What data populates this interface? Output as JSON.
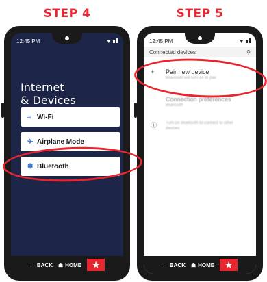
{
  "steps": {
    "step4": {
      "label": "STEP 4"
    },
    "step5": {
      "label": "STEP 5"
    }
  },
  "phone4": {
    "time": "12:45 PM",
    "title_line1": "Internet",
    "title_line2": "& Devices",
    "menu": [
      {
        "label": "Wi-Fi",
        "icon": "wifi-icon"
      },
      {
        "label": "Airplane Mode",
        "icon": "airplane-icon"
      },
      {
        "label": "Bluetooth",
        "icon": "bluetooth-icon"
      }
    ]
  },
  "phone5": {
    "time": "12:45 PM",
    "header": "Connected devices",
    "rows": [
      {
        "title": "Pair new device",
        "sub": "Bluetooth will turn on to pair"
      },
      {
        "title": "Connection preferences",
        "sub": "Bluetooth"
      },
      {
        "title": "",
        "sub": "Turn on Bluetooth to connect to other devices"
      }
    ]
  },
  "navbar": {
    "back": "BACK",
    "home": "HOME"
  },
  "colors": {
    "accent": "#e8262f",
    "screen_dark": "#1d2548",
    "icon_blue": "#3a7bd5"
  }
}
